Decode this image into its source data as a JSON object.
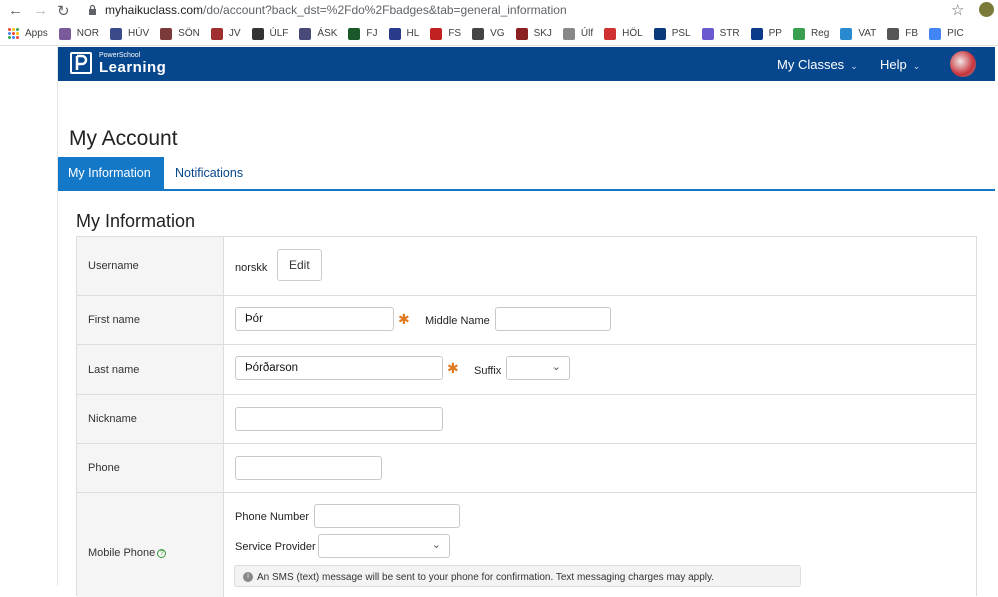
{
  "browser": {
    "url_host": "myhaikuclass.com",
    "url_path": "/do/account?back_dst=%2Fdo%2Fbadges&tab=general_information",
    "bookmarks": [
      {
        "label": "Apps",
        "color": "#4285f4"
      },
      {
        "label": "NOR",
        "color": "#7a5a9a"
      },
      {
        "label": "HÚV",
        "color": "#3a4a8a"
      },
      {
        "label": "SÖN",
        "color": "#7a3a3a"
      },
      {
        "label": "JV",
        "color": "#a03030"
      },
      {
        "label": "ÚLF",
        "color": "#333"
      },
      {
        "label": "ÁSK",
        "color": "#4a4a7a"
      },
      {
        "label": "FJ",
        "color": "#1a5a2a"
      },
      {
        "label": "HL",
        "color": "#2a3a8a"
      },
      {
        "label": "FS",
        "color": "#c02020"
      },
      {
        "label": "VG",
        "color": "#444"
      },
      {
        "label": "SKJ",
        "color": "#8a2020"
      },
      {
        "label": "Úlf",
        "color": "#888"
      },
      {
        "label": "HÖL",
        "color": "#d03030"
      },
      {
        "label": "PSL",
        "color": "#0a3a7a"
      },
      {
        "label": "STR",
        "color": "#6a5ad0"
      },
      {
        "label": "PP",
        "color": "#0a3a8a"
      },
      {
        "label": "Reg",
        "color": "#3aa050"
      },
      {
        "label": "VAT",
        "color": "#2a8ad0"
      },
      {
        "label": "FB",
        "color": "#555"
      },
      {
        "label": "PIC",
        "color": "#4285f4"
      }
    ]
  },
  "header": {
    "logo_small": "PowerSchool",
    "logo_big": "Learning",
    "menu_classes": "My Classes",
    "menu_help": "Help"
  },
  "page": {
    "title": "My Account",
    "tabs": [
      "My Information",
      "Notifications"
    ],
    "section_title": "My Information"
  },
  "form": {
    "username_label": "Username",
    "username_value": "norskk",
    "edit_button": "Edit",
    "first_name_label": "First name",
    "first_name_value": "Þór",
    "middle_name_label": "Middle Name",
    "middle_name_value": "",
    "last_name_label": "Last name",
    "last_name_value": "Þórðarson",
    "suffix_label": "Suffix",
    "suffix_value": "",
    "nickname_label": "Nickname",
    "nickname_value": "",
    "phone_label": "Phone",
    "phone_value": "",
    "mobile_label": "Mobile Phone",
    "phone_number_label": "Phone Number",
    "phone_number_value": "",
    "service_provider_label": "Service Provider",
    "service_provider_value": "",
    "sms_notice": "An SMS (text) message will be sent to your phone for confirmation. Text messaging charges may apply."
  }
}
